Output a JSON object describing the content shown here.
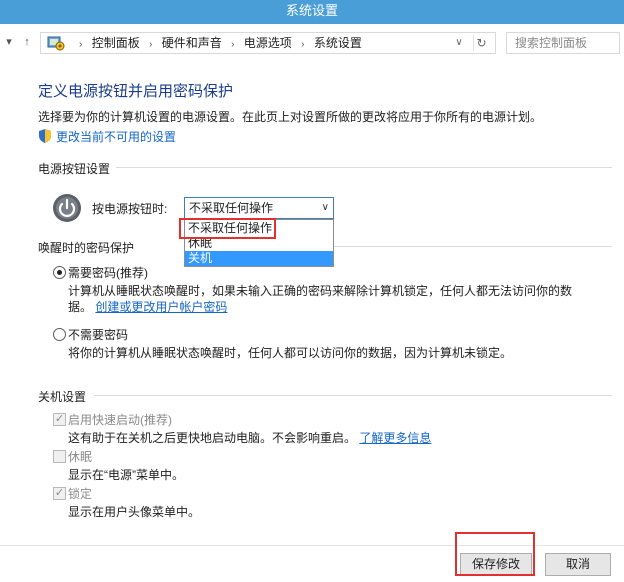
{
  "window": {
    "title": "系统设置"
  },
  "address_bar": {
    "breadcrumbs": [
      "控制面板",
      "硬件和声音",
      "电源选项",
      "系统设置"
    ],
    "search_placeholder": "搜索控制面板"
  },
  "header": {
    "title": "定义电源按钮并启用密码保护",
    "description": "选择要为你的计算机设置的电源设置。在此页上对设置所做的更改将应用于你所有的电源计划。",
    "change_link": "更改当前不可用的设置"
  },
  "power_button_settings": {
    "heading": "电源按钮设置",
    "label": "按电源按钮时:",
    "selected_value": "不采取任何操作",
    "options": [
      "不采取任何操作",
      "休眠",
      "关机"
    ],
    "highlighted_option": "关机"
  },
  "wake_password": {
    "heading": "唤醒时的密码保护",
    "require": {
      "label": "需要密码(推荐)",
      "desc": "计算机从睡眠状态唤醒时，如果未输入正确的密码来解除计算机锁定，任何人都无法访问你的数",
      "desc2": "据。",
      "link": "创建或更改用户帐户密码",
      "selected": true
    },
    "no_require": {
      "label": "不需要密码",
      "desc": "将你的计算机从睡眠状态唤醒时，任何人都可以访问你的数据，因为计算机未锁定。",
      "selected": false
    }
  },
  "shutdown_settings": {
    "heading": "关机设置",
    "fast_startup": {
      "label": "启用快速启动(推荐)",
      "desc": "这有助于在关机之后更快地启动电脑。不会影响重启。",
      "link": "了解更多信息",
      "checked": true
    },
    "hibernate": {
      "label": "休眠",
      "desc": "显示在“电源”菜单中。",
      "checked": false
    },
    "lock": {
      "label": "锁定",
      "desc": "显示在用户头像菜单中。",
      "checked": true
    }
  },
  "footer": {
    "save_label": "保存修改",
    "cancel_label": "取消"
  },
  "colors": {
    "title_bar": "#4a9ed8",
    "heading": "#1a3d8f",
    "link": "#1466c8",
    "highlight": "#3399ff",
    "annotation": "#e0312f"
  }
}
